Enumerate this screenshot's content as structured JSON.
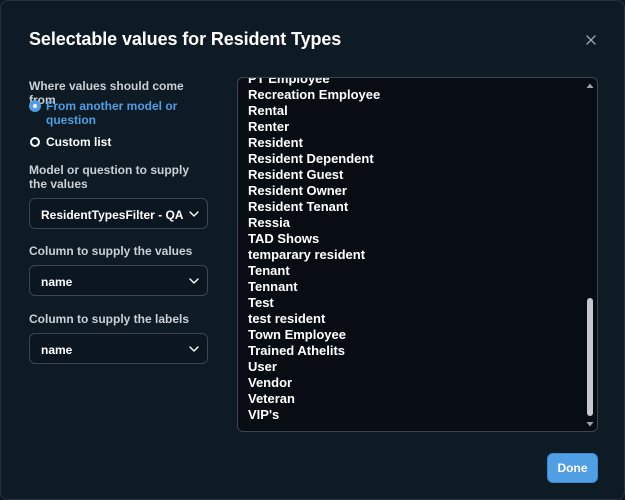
{
  "dialog": {
    "title": "Selectable values for Resident Types"
  },
  "source": {
    "label": "Where values should come from",
    "options": [
      {
        "label": "From another model or question",
        "selected": true
      },
      {
        "label": "Custom list",
        "selected": false
      }
    ]
  },
  "model": {
    "label": "Model or question to supply the values",
    "value": "ResidentTypesFilter - QA"
  },
  "values_column": {
    "label": "Column to supply the values",
    "value": "name"
  },
  "labels_column": {
    "label": "Column to supply the labels",
    "value": "name"
  },
  "values_list": [
    "PT Employee",
    "Recreation Employee",
    "Rental",
    "Renter",
    "Resident",
    "Resident Dependent",
    "Resident Guest",
    "Resident Owner",
    "Resident Tenant",
    "Ressia",
    "TAD Shows",
    "temparary resident",
    "Tenant",
    "Tennant",
    "Test",
    "test resident",
    "Town Employee",
    "Trained Athelits",
    "User",
    "Vendor",
    "Veteran",
    "VIP's"
  ],
  "footer": {
    "done_label": "Done"
  },
  "colors": {
    "accent": "#509ee3",
    "background": "#0e1a24"
  },
  "icons": {
    "close": "close-icon",
    "chevron": "chevron-down-icon"
  }
}
